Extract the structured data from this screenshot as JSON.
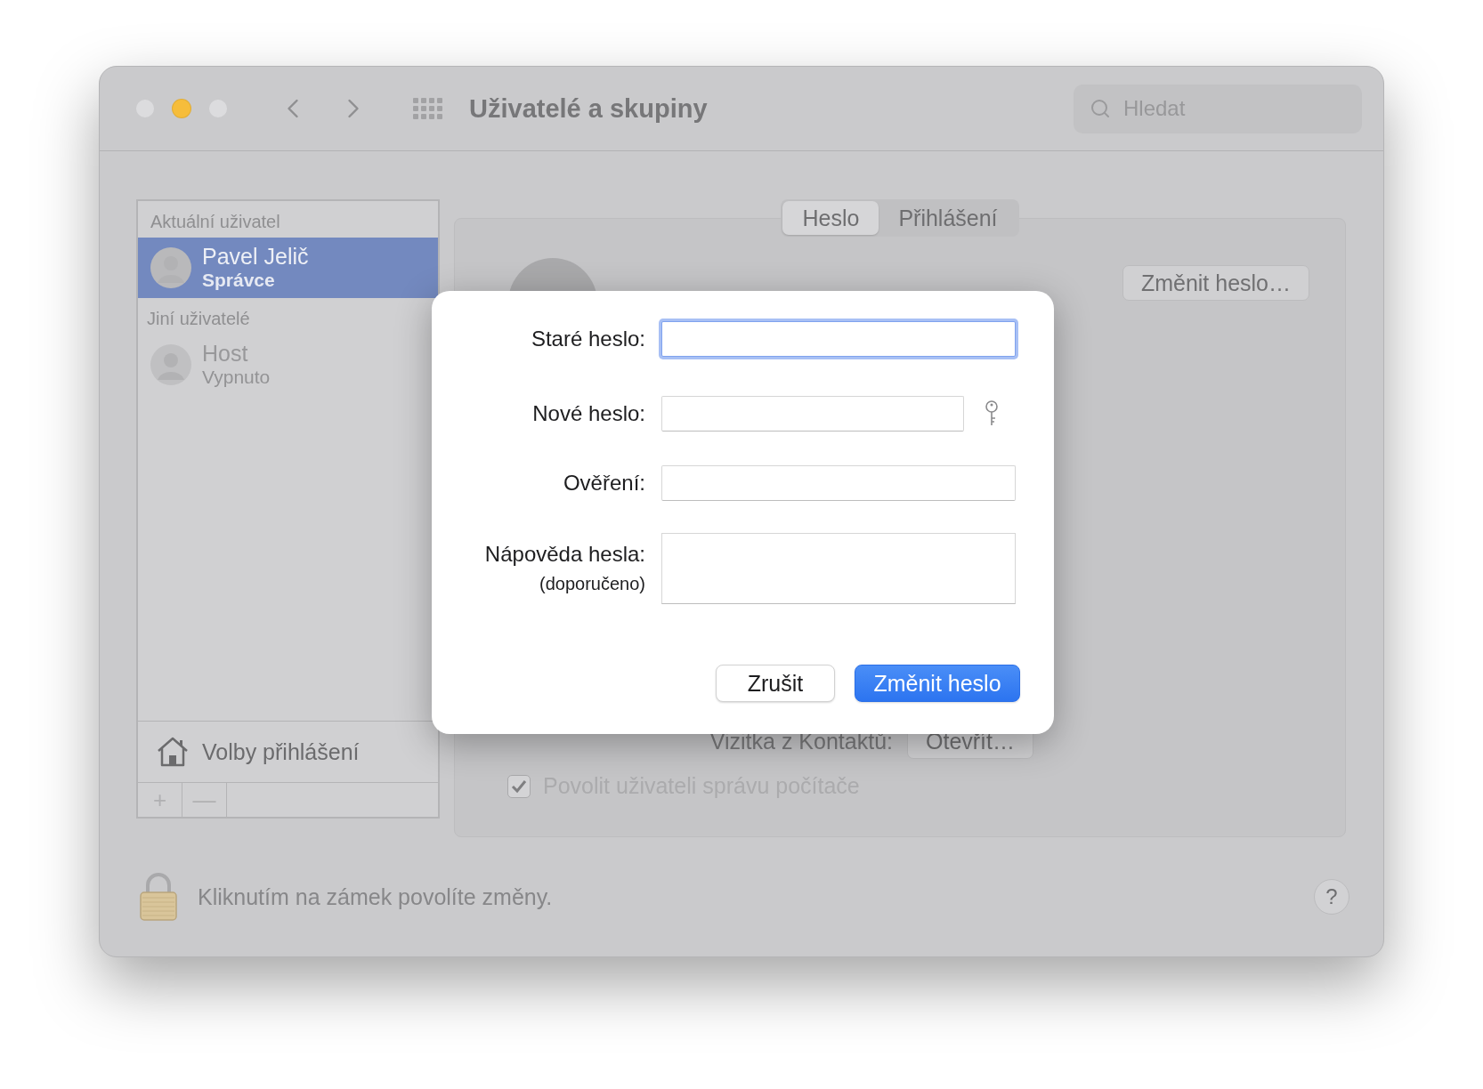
{
  "window": {
    "title": "Uživatelé a skupiny",
    "search": {
      "placeholder": "Hledat"
    }
  },
  "sidebar": {
    "sections": [
      {
        "heading": "Aktuální uživatel",
        "users": [
          {
            "name": "Pavel Jelič",
            "role": "Správce",
            "selected": true,
            "disabled": false
          }
        ]
      },
      {
        "heading": "Jiní uživatelé",
        "users": [
          {
            "name": "Host",
            "role": "Vypnuto",
            "selected": false,
            "disabled": true
          }
        ]
      }
    ],
    "login_options": "Volby přihlášení",
    "buttons": [
      "+",
      "—"
    ]
  },
  "tabs": [
    {
      "label": "Heslo",
      "selected": true
    },
    {
      "label": "Přihlášení",
      "selected": false
    }
  ],
  "account": {
    "change_password": "Změnit heslo…",
    "contact_card_label": "Vizitka z Kontaktů:",
    "open_button": "Otevřít…",
    "admin": {
      "label": "Povolit uživateli správu počítače",
      "checked": true
    }
  },
  "lock": {
    "text": "Kliknutím na zámek povolíte změny."
  },
  "help": "?",
  "dialog": {
    "fields": [
      {
        "kind": "line",
        "label": "Staré heslo:",
        "focused": true
      },
      {
        "kind": "key",
        "label": "Nové heslo:",
        "focused": false
      },
      {
        "kind": "line",
        "label": "Ověření:",
        "focused": false
      },
      {
        "kind": "area",
        "label": "Nápověda hesla:",
        "note": "(doporučeno)",
        "focused": false
      }
    ],
    "buttons": [
      {
        "label": "Zrušit",
        "default": false
      },
      {
        "label": "Změnit heslo",
        "default": true
      }
    ]
  }
}
